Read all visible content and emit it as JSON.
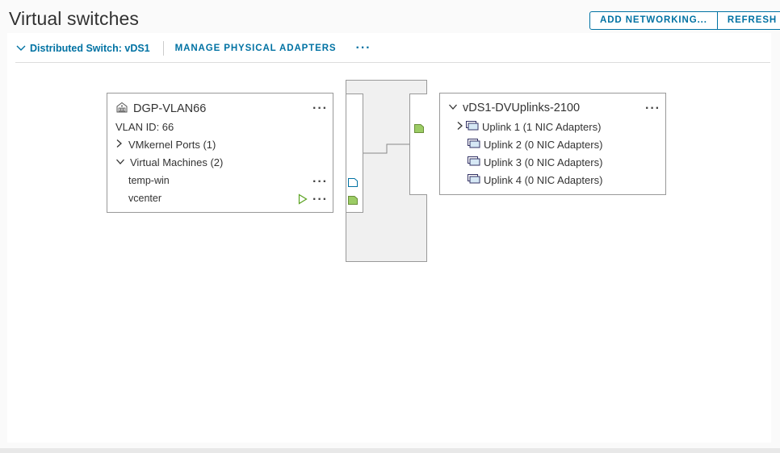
{
  "header": {
    "title": "Virtual switches",
    "add_networking_label": "ADD NETWORKING...",
    "refresh_label": "REFRESH"
  },
  "switch": {
    "label": "Distributed Switch: vDS1",
    "manage_label": "MANAGE PHYSICAL ADAPTERS",
    "more_label": "···"
  },
  "portgroup": {
    "name": "DGP-VLAN66",
    "vlan": "VLAN ID: 66",
    "vmkernel": "VMkernel Ports (1)",
    "vms_label": "Virtual Machines (2)",
    "vms": [
      {
        "name": "temp-win",
        "powered_on": false
      },
      {
        "name": "vcenter",
        "powered_on": true
      }
    ]
  },
  "uplinks": {
    "name": "vDS1-DVUplinks-2100",
    "items": [
      {
        "label": "Uplink 1 (1 NIC Adapters)",
        "expandable": true
      },
      {
        "label": "Uplink 2 (0 NIC Adapters)",
        "expandable": false
      },
      {
        "label": "Uplink 3 (0 NIC Adapters)",
        "expandable": false
      },
      {
        "label": "Uplink 4 (0 NIC Adapters)",
        "expandable": false
      }
    ]
  },
  "colors": {
    "accent": "#0072a3",
    "port_active": "#9ccc65",
    "play_icon": "#5aa220"
  },
  "icons": {
    "portgroup": "portgroup-icon",
    "uplink": "nic-adapter-icon",
    "power_on": "play-icon"
  }
}
